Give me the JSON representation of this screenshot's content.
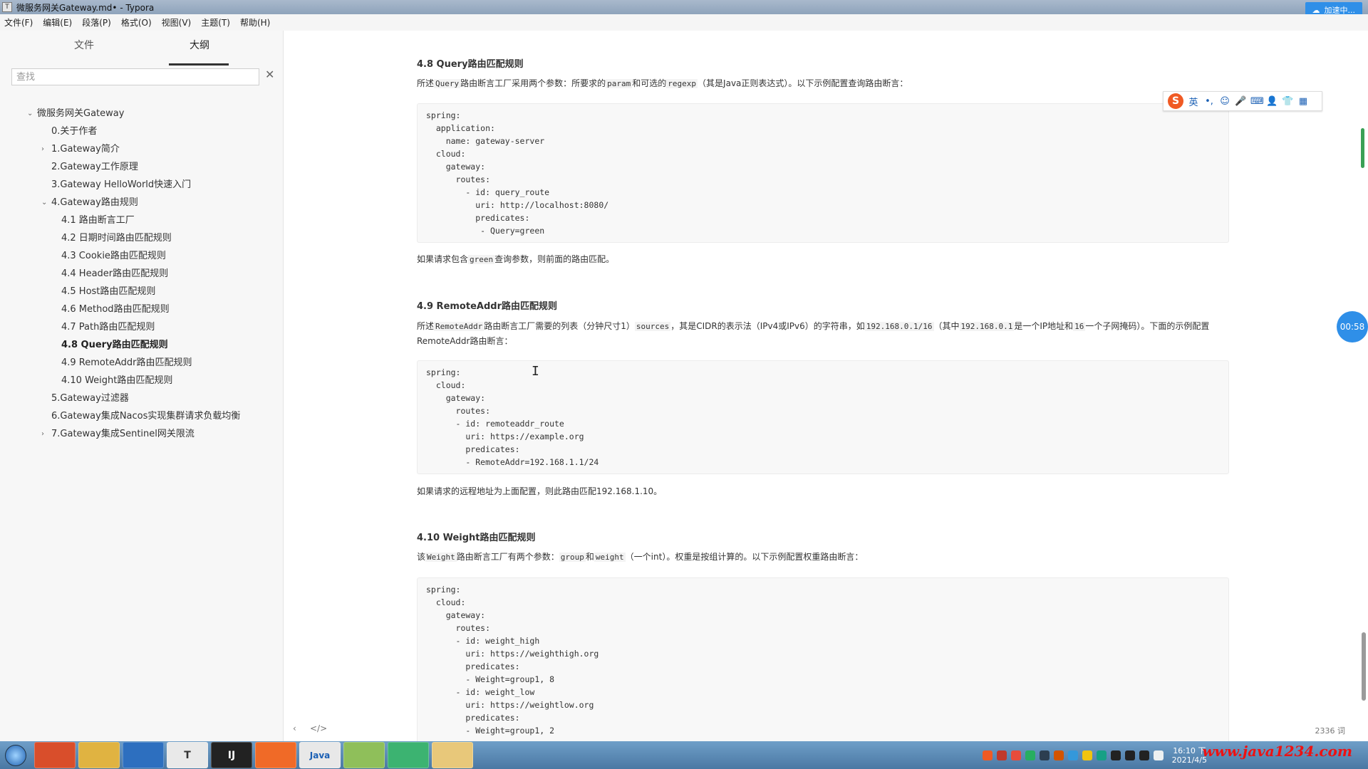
{
  "window": {
    "title": "微服务网关Gateway.md• - Typora",
    "app_icon": "T"
  },
  "cloud_badge": {
    "label": "加速中..."
  },
  "menubar": {
    "items": [
      "文件(F)",
      "编辑(E)",
      "段落(P)",
      "格式(O)",
      "视图(V)",
      "主题(T)",
      "帮助(H)"
    ]
  },
  "sidebar": {
    "tabs": {
      "files": "文件",
      "outline": "大纲"
    },
    "search": {
      "placeholder": "查找",
      "value": ""
    },
    "outline": [
      {
        "label": "微服务网关Gateway",
        "level": 0,
        "chevron": "⌄"
      },
      {
        "label": "0.关于作者",
        "level": 1,
        "chevron": ""
      },
      {
        "label": "1.Gateway简介",
        "level": 1,
        "chevron": "›"
      },
      {
        "label": "2.Gateway工作原理",
        "level": 1,
        "chevron": ""
      },
      {
        "label": "3.Gateway HelloWorld快速入门",
        "level": 1,
        "chevron": ""
      },
      {
        "label": "4.Gateway路由规则",
        "level": 1,
        "chevron": "⌄"
      },
      {
        "label": "4.1 路由断言工厂",
        "level": 2,
        "chevron": ""
      },
      {
        "label": "4.2 日期时间路由匹配规则",
        "level": 2,
        "chevron": ""
      },
      {
        "label": "4.3 Cookie路由匹配规则",
        "level": 2,
        "chevron": ""
      },
      {
        "label": "4.4 Header路由匹配规则",
        "level": 2,
        "chevron": ""
      },
      {
        "label": "4.5 Host路由匹配规则",
        "level": 2,
        "chevron": ""
      },
      {
        "label": "4.6 Method路由匹配规则",
        "level": 2,
        "chevron": ""
      },
      {
        "label": "4.7 Path路由匹配规则",
        "level": 2,
        "chevron": ""
      },
      {
        "label": "4.8 Query路由匹配规则",
        "level": 2,
        "chevron": "",
        "active": true
      },
      {
        "label": "4.9 RemoteAddr路由匹配规则",
        "level": 2,
        "chevron": ""
      },
      {
        "label": "4.10 Weight路由匹配规则",
        "level": 2,
        "chevron": ""
      },
      {
        "label": "5.Gateway过滤器",
        "level": 1,
        "chevron": ""
      },
      {
        "label": "6.Gateway集成Nacos实现集群请求负载均衡",
        "level": 1,
        "chevron": ""
      },
      {
        "label": "7.Gateway集成Sentinel网关限流",
        "level": 1,
        "chevron": "›"
      }
    ]
  },
  "doc": {
    "s48": {
      "heading": "4.8 Query路由匹配规则",
      "intro_a": "所述",
      "intro_code1": "Query",
      "intro_b": "路由断言工厂采用两个参数：所要求的",
      "intro_code2": "param",
      "intro_c": "和可选的",
      "intro_code3": "regexp",
      "intro_d": "（其是Java正则表达式）。以下示例配置查询路由断言：",
      "code": "spring:\n  application:\n    name: gateway-server\n  cloud:\n    gateway:\n      routes:\n        - id: query_route\n          uri: http://localhost:8080/\n          predicates:\n           - Query=green",
      "note_a": "如果请求包含",
      "note_code": "green",
      "note_b": "查询参数，则前面的路由匹配。"
    },
    "s49": {
      "heading": "4.9 RemoteAddr路由匹配规则",
      "intro_a": "所述",
      "intro_code1": "RemoteAddr",
      "intro_b": "路由断言工厂需要的列表（分钟尺寸1）",
      "intro_code2": "sources",
      "intro_c": "，其是CIDR的表示法（IPv4或IPv6）的字符串，如",
      "intro_code3": "192.168.0.1/16",
      "intro_d": "（其中",
      "intro_code4": "192.168.0.1",
      "intro_e": "是一个IP地址和",
      "intro_code5": "16",
      "intro_f": "一个子网掩码）。下面的示例配置RemoteAddr路由断言：",
      "code": "spring:\n  cloud:\n    gateway:\n      routes:\n      - id: remoteaddr_route\n        uri: https://example.org\n        predicates:\n        - RemoteAddr=192.168.1.1/24",
      "note": "如果请求的远程地址为上面配置，则此路由匹配192.168.1.10。"
    },
    "s410": {
      "heading": "4.10  Weight路由匹配规则",
      "intro_a": "该",
      "intro_code1": "Weight",
      "intro_b": "路由断言工厂有两个参数：",
      "intro_code2": "group",
      "intro_c": "和",
      "intro_code3": "weight",
      "intro_d": "（一个int）。权重是按组计算的。以下示例配置权重路由断言：",
      "code": "spring:\n  cloud:\n    gateway:\n      routes:\n      - id: weight_high\n        uri: https://weighthigh.org\n        predicates:\n        - Weight=group1, 8\n      - id: weight_low\n        uri: https://weightlow.org\n        predicates:\n        - Weight=group1, 2"
    }
  },
  "ime": {
    "logo": "S",
    "mode": "英",
    "items": [
      "•,",
      "☺",
      "🎤",
      "⌨",
      "👤",
      "👕",
      "▦"
    ]
  },
  "timer": {
    "label": "00:58"
  },
  "statusbar": {
    "nav_left": "‹",
    "nav_src": "</>",
    "word_count": "2336 词"
  },
  "taskbar": {
    "apps": [
      "",
      "",
      "",
      "T",
      "IJ",
      "",
      "Java",
      "",
      "",
      ""
    ],
    "clock_time": "16:10 下",
    "clock_date": "2021/4/5",
    "watermark": "www.java1234.com"
  }
}
